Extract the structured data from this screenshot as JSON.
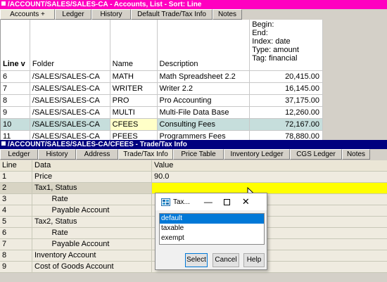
{
  "window1": {
    "title": "/ACCOUNT/SALES/SALES-CA - Accounts, List - Sort: Line",
    "tabs": [
      "Accounts  +",
      "Ledger",
      "History",
      "Default Trade/Tax Info",
      "Notes"
    ],
    "header": {
      "line": "Line  v",
      "folder": "Folder",
      "name": "Name",
      "description": "Description",
      "info": [
        "Begin:",
        "End:",
        "Index:  date",
        "Type:   amount",
        "Tag:     financial"
      ]
    },
    "rows": [
      {
        "line": "6",
        "folder": "/SALES/SALES-CA",
        "name": "MATH",
        "description": "Math Spreadsheet 2.2",
        "amount": "20,415.00"
      },
      {
        "line": "7",
        "folder": "/SALES/SALES-CA",
        "name": "WRITER",
        "description": "Writer 2.2",
        "amount": "16,145.00"
      },
      {
        "line": "8",
        "folder": "/SALES/SALES-CA",
        "name": "PRO",
        "description": "Pro Accounting",
        "amount": "37,175.00"
      },
      {
        "line": "9",
        "folder": "/SALES/SALES-CA",
        "name": "MULTI",
        "description": "Multi-File Data Base",
        "amount": "12,260.00"
      },
      {
        "line": "10",
        "folder": "/SALES/SALES-CA",
        "name": "CFEES",
        "description": "Consulting Fees",
        "amount": "72,167.00"
      },
      {
        "line": "11",
        "folder": "/SALES/SALES-CA",
        "name": "PFEES",
        "description": "Programmers Fees",
        "amount": "78,880.00"
      }
    ]
  },
  "window2": {
    "title": "/ACCOUNT/SALES/SALES-CA/CFEES - Trade/Tax Info",
    "tabs": [
      "Ledger",
      "History",
      "Address",
      "Trade/Tax Info",
      "Price Table",
      "Inventory Ledger",
      "CGS Ledger",
      "Notes"
    ],
    "header": {
      "line": "Line",
      "data": "Data",
      "value": "Value"
    },
    "rows": [
      {
        "line": "1",
        "data": "Price",
        "value": "90.0"
      },
      {
        "line": "2",
        "data": "Tax1, Status",
        "value": ""
      },
      {
        "line": "3",
        "data": "        Rate",
        "value": ""
      },
      {
        "line": "4",
        "data": "        Payable Account",
        "value": ""
      },
      {
        "line": "5",
        "data": "Tax2, Status",
        "value": ""
      },
      {
        "line": "6",
        "data": "        Rate",
        "value": ""
      },
      {
        "line": "7",
        "data": "        Payable Account",
        "value": ""
      },
      {
        "line": "8",
        "data": "Inventory Account",
        "value": ""
      },
      {
        "line": "9",
        "data": "Cost of Goods Account",
        "value": ""
      }
    ]
  },
  "dialog": {
    "title": "Tax...",
    "options": [
      "default",
      "taxable",
      "exempt"
    ],
    "selected": "default",
    "buttons": {
      "select": "Select",
      "cancel": "Cancel",
      "help": "Help"
    }
  }
}
